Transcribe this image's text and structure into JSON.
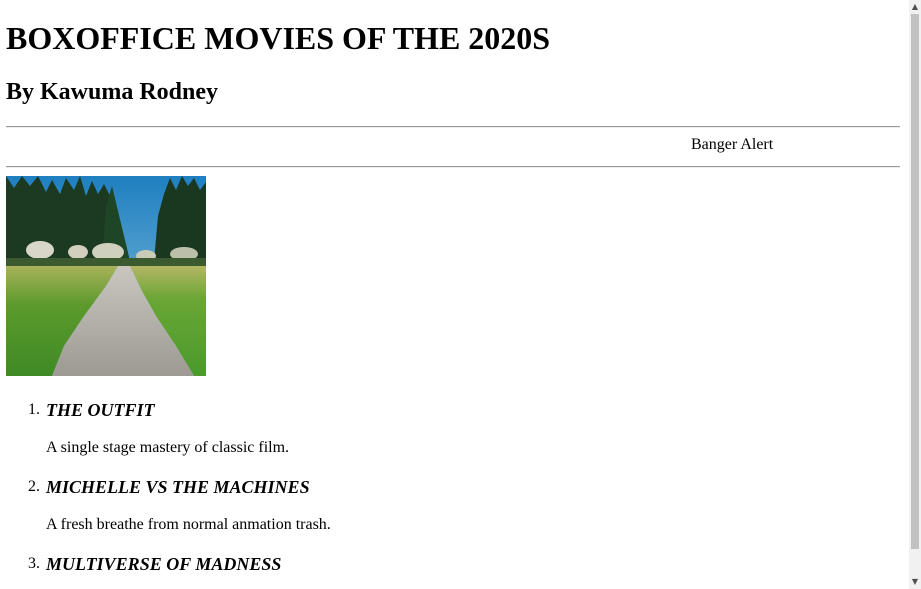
{
  "header": {
    "title": "BOXOFFICE MOVIES OF THE 2020S",
    "author": "By Kawuma Rodney"
  },
  "marquee": {
    "text": "Banger Alert"
  },
  "image": {
    "description_icon": "landscape-path-image"
  },
  "movies": [
    {
      "number": "1.",
      "title": "THE OUTFIT",
      "description": "A single stage mastery of classic film."
    },
    {
      "number": "2.",
      "title": "MICHELLE VS THE MACHINES",
      "description": "A fresh breathe from normal anmation trash."
    },
    {
      "number": "3.",
      "title": "MULTIVERSE OF MADNESS",
      "description": ""
    }
  ],
  "scrollbar": {
    "up_icon": "arrow-up-icon",
    "down_icon": "arrow-down-icon"
  }
}
